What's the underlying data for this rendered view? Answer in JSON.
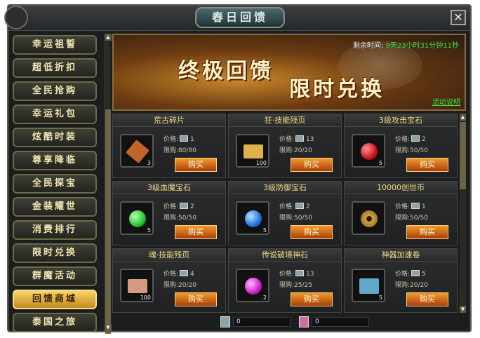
{
  "window": {
    "title": "春日回馈",
    "close_label": "✕"
  },
  "sidebar": {
    "items": [
      {
        "label": "幸运祖誓"
      },
      {
        "label": "超低折扣"
      },
      {
        "label": "全民抢购"
      },
      {
        "label": "幸运礼包"
      },
      {
        "label": "炫酷时装"
      },
      {
        "label": "尊享降临"
      },
      {
        "label": "全民探宝"
      },
      {
        "label": "金装耀世"
      },
      {
        "label": "消费排行"
      },
      {
        "label": "限时兑换"
      },
      {
        "label": "群魔活动"
      },
      {
        "label": "回馈商城"
      },
      {
        "label": "泰国之旅"
      }
    ],
    "active_index": 11
  },
  "banner": {
    "title_1": "终极回馈",
    "title_2": "限时兑换",
    "timer_label": "剩余时间:",
    "timer_value": "9天23小时31分钟11秒",
    "rules_link": "活动说明"
  },
  "shop": {
    "price_label": "价格:",
    "limit_label": "限购:",
    "buy_label": "购买",
    "items": [
      {
        "name": "荒古碎片",
        "price": "1",
        "limit": "80/80",
        "count": "3",
        "color": "#c0642a"
      },
      {
        "name": "狂·技能残页",
        "price": "13",
        "limit": "20/20",
        "count": "100",
        "color": "#e0b24a"
      },
      {
        "name": "3级攻击宝石",
        "price": "2",
        "limit": "50/50",
        "count": "5",
        "color": "#d41a24"
      },
      {
        "name": "3级血魔宝石",
        "price": "2",
        "limit": "50/50",
        "count": "5",
        "color": "#2fcf39"
      },
      {
        "name": "3级防御宝石",
        "price": "2",
        "limit": "50/50",
        "count": "5",
        "color": "#2b7fe6"
      },
      {
        "name": "10000创世币",
        "price": "1",
        "limit": "50/50",
        "count": "",
        "color": "#d0a645"
      },
      {
        "name": "魂·技能残页",
        "price": "4",
        "limit": "20/20",
        "count": "100",
        "color": "#d59a80"
      },
      {
        "name": "传说破境神石",
        "price": "13",
        "limit": "25/25",
        "count": "2",
        "color": "#d72ad0"
      },
      {
        "name": "神器加速卷",
        "price": "5",
        "limit": "20/20",
        "count": "5",
        "color": "#5fa8c6"
      }
    ]
  },
  "footer": {
    "balance_1": "0",
    "balance_2": "0"
  }
}
